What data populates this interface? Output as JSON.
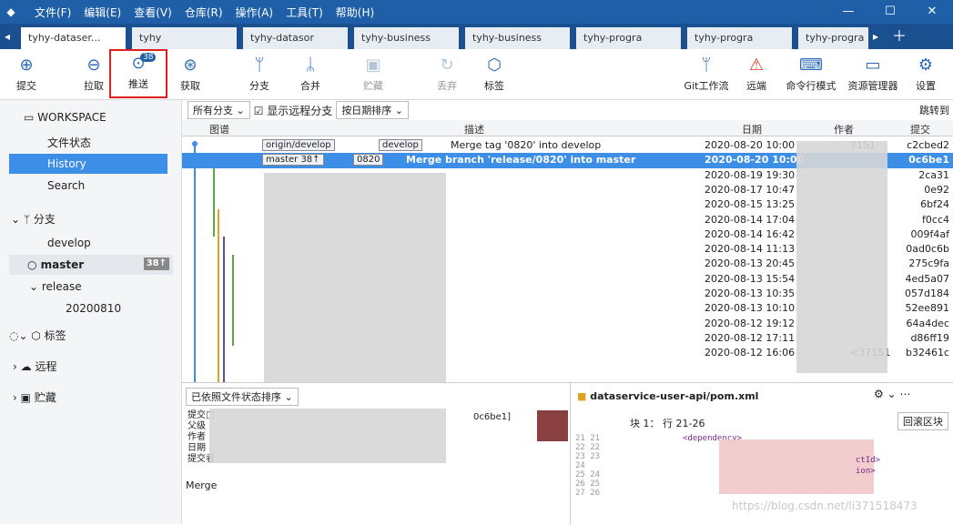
{
  "menu": [
    "文件(F)",
    "编辑(E)",
    "查看(V)",
    "仓库(R)",
    "操作(A)",
    "工具(T)",
    "帮助(H)"
  ],
  "tabs": [
    "tyhy-dataser...",
    "tyhy",
    "tyhy-datasor",
    "tyhy-business",
    "tyhy-business",
    "tyhy-progra",
    "tyhy-progra",
    "tyhy-progra"
  ],
  "toolbar": {
    "commit": "提交",
    "pull": "拉取",
    "push": "推送",
    "push_badge": "38",
    "fetch": "获取",
    "branch": "分支",
    "merge": "合并",
    "stash": "贮藏",
    "discard": "丢弃",
    "tag": "标签",
    "gitflow": "Git工作流",
    "remote": "远端",
    "terminal": "命令行模式",
    "explorer": "资源管理器",
    "settings": "设置"
  },
  "sidebar": {
    "workspace": "WORKSPACE",
    "file_status": "文件状态",
    "history": "History",
    "search": "Search",
    "branches": "分支",
    "develop": "develop",
    "master": "master",
    "master_ahead": "38↑",
    "release": "release",
    "release_item": "20200810",
    "tags": "标签",
    "remotes": "远程",
    "stashes": "贮藏"
  },
  "filter": {
    "all_branches": "所有分支 ⌄",
    "show_remote": "显示远程分支",
    "sort": "按日期排序 ⌄",
    "jump": "跳转到"
  },
  "columns": {
    "graph": "图谱",
    "desc": "描述",
    "date": "日期",
    "author": "作者",
    "commit": "提交"
  },
  "rows": [
    {
      "tags": [
        "origin/develop",
        "develop"
      ],
      "desc": "Merge tag '0820' into develop",
      "date": "2020-08-20 10:00",
      "author": "7151",
      "hash": "c2cbed2"
    },
    {
      "tags": [
        "master 38↑",
        "0820"
      ],
      "desc": "Merge branch 'release/0820' into master",
      "date": "2020-08-20 10:00",
      "author": "",
      "hash": "0c6be1"
    },
    {
      "tags": [],
      "desc": "",
      "date": "2020-08-19 19:30",
      "author": "",
      "hash": "2ca31"
    },
    {
      "tags": [],
      "desc": "",
      "date": "2020-08-17 10:47",
      "author": "",
      "hash": "0e92"
    },
    {
      "tags": [],
      "desc": "",
      "date": "2020-08-15 13:25",
      "author": "",
      "hash": "6bf24"
    },
    {
      "tags": [],
      "desc": "",
      "date": "2020-08-14 17:04",
      "author": "",
      "hash": "f0cc4"
    },
    {
      "tags": [],
      "desc": "",
      "date": "2020-08-14 16:42",
      "author": "",
      "hash": "009f4af"
    },
    {
      "tags": [],
      "desc": "",
      "date": "2020-08-14 11:13",
      "author": "",
      "hash": "0ad0c6b"
    },
    {
      "tags": [],
      "desc": "",
      "date": "2020-08-13 20:45",
      "author": "",
      "hash": "275c9fa"
    },
    {
      "tags": [],
      "desc": "",
      "date": "2020-08-13 15:54",
      "author": "",
      "hash": "4ed5a07"
    },
    {
      "tags": [],
      "desc": "",
      "date": "2020-08-13 10:35",
      "author": "",
      "hash": "057d184"
    },
    {
      "tags": [],
      "desc": "",
      "date": "2020-08-13 10:10",
      "author": "",
      "hash": "52ee891"
    },
    {
      "tags": [],
      "desc": "",
      "date": "2020-08-12 19:12",
      "author": "",
      "hash": "64a4dec"
    },
    {
      "tags": [],
      "desc": "",
      "date": "2020-08-12 17:11",
      "author": "",
      "hash": "d86ff19"
    },
    {
      "tags": [],
      "desc": "",
      "date": "2020-08-12 16:06",
      "author": "<37151",
      "hash": "b32461c"
    }
  ],
  "bottom": {
    "sort": "已依照文件状态排序 ⌄",
    "file": "dataservice-user-api/pom.xml",
    "hunk": "块 1： 行 21-26",
    "revert": "回滚区块",
    "commit_label": "提交□",
    "hash_tail": "0c6be1]",
    "parent": "父级",
    "author": "作者",
    "date": "日期",
    "committer": "提交者",
    "merge": "Merge",
    "watermark": "https://blog.csdn.net/li371518473",
    "code": [
      "<dependency>",
      "ctId>",
      "ion>"
    ]
  }
}
